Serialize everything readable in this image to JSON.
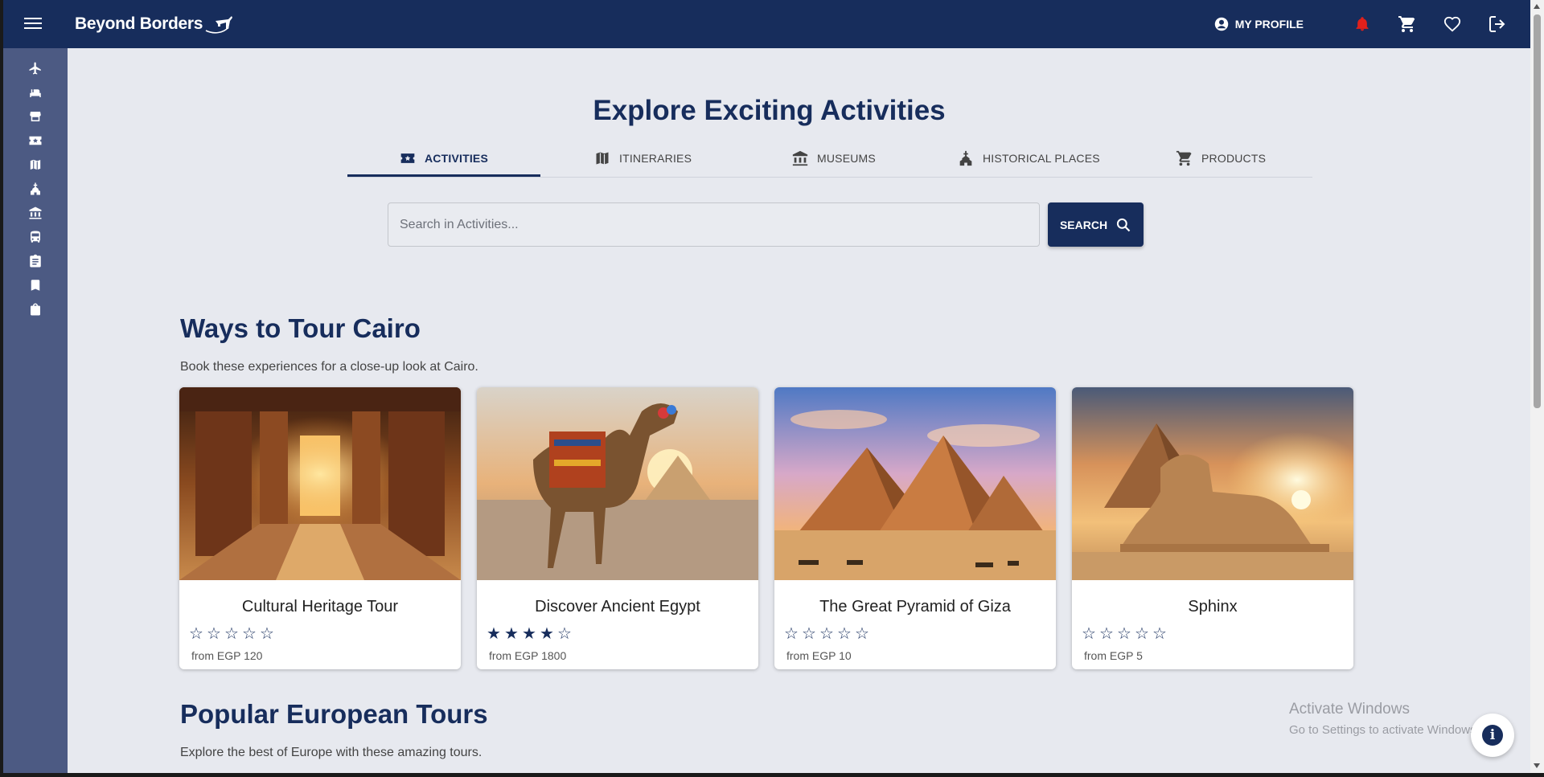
{
  "header": {
    "brand": "Beyond Borders",
    "profile_label": "MY PROFILE",
    "icons": [
      "menu-icon",
      "account-circle-icon",
      "bell-icon",
      "cart-icon",
      "heart-icon",
      "logout-icon"
    ],
    "notification_color": "#e0201b"
  },
  "sidebar": {
    "items": [
      "airplane-icon",
      "bed-icon",
      "store-icon",
      "ticket-icon",
      "map-icon",
      "church-icon",
      "museum-icon",
      "bus-icon",
      "clipboard-icon",
      "bookmark-icon",
      "shopping-bag-icon"
    ]
  },
  "main": {
    "title": "Explore Exciting Activities",
    "tabs": [
      {
        "label": "ACTIVITIES",
        "icon": "ticket-icon",
        "active": true
      },
      {
        "label": "ITINERARIES",
        "icon": "map-icon",
        "active": false
      },
      {
        "label": "MUSEUMS",
        "icon": "museum-icon",
        "active": false
      },
      {
        "label": "HISTORICAL PLACES",
        "icon": "church-icon",
        "active": false
      },
      {
        "label": "PRODUCTS",
        "icon": "cart-icon",
        "active": false
      }
    ],
    "search": {
      "placeholder": "Search in Activities...",
      "value": "",
      "button_label": "SEARCH"
    }
  },
  "sections": [
    {
      "title": "Ways to Tour Cairo",
      "subtitle": "Book these experiences for a close-up look at Cairo.",
      "cards": [
        {
          "name": "Cultural Heritage Tour",
          "rating": 0,
          "price": "from EGP 120"
        },
        {
          "name": "Discover Ancient Egypt",
          "rating": 4,
          "price": "from EGP 1800"
        },
        {
          "name": "The Great Pyramid of Giza",
          "rating": 0,
          "price": "from EGP 10"
        },
        {
          "name": "Sphinx",
          "rating": 0,
          "price": "from EGP 5"
        }
      ]
    },
    {
      "title": "Popular European Tours",
      "subtitle": "Explore the best of Europe with these amazing tours."
    }
  ],
  "watermark": {
    "line1": "Activate Windows",
    "line2": "Go to Settings to activate Windows."
  },
  "colors": {
    "primary": "#172d5c",
    "sidebar": "#4c5a83",
    "background": "#e7e9ef"
  }
}
